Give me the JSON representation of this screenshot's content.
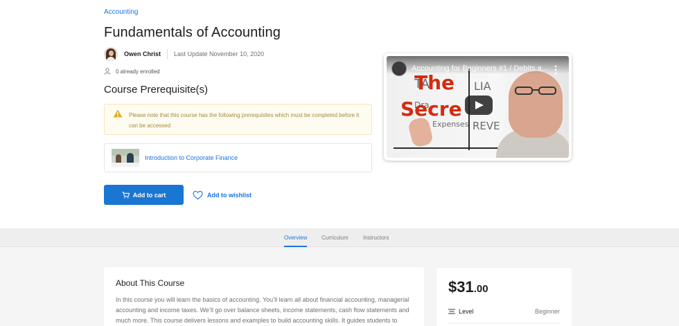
{
  "breadcrumb": {
    "category": "Accounting"
  },
  "course": {
    "title": "Fundamentals of Accounting",
    "author": "Owen Christ",
    "last_update": "Last Update November 10, 2020",
    "enrolled": "0 already enrolled"
  },
  "prerequisites": {
    "heading": "Course Prerequisite(s)",
    "notice": "Please note that this course has the following prerequisites which must be completed before it can be accessed",
    "items": [
      {
        "title": "Introduction to Corporate Finance"
      }
    ]
  },
  "actions": {
    "add_to_cart": "Add to cart",
    "add_to_wishlist": "Add to wishlist"
  },
  "video": {
    "title": "Accounting for Beginners #1 / Debits a...",
    "overlay_big_text_1": "The",
    "overlay_big_text_2": "Secre",
    "board_words": [
      "TA",
      "LIA",
      "Dra",
      "Expenses",
      "REVE"
    ]
  },
  "tabs": [
    {
      "label": "Overview",
      "active": true
    },
    {
      "label": "Curriculum",
      "active": false
    },
    {
      "label": "Instructors",
      "active": false
    }
  ],
  "about": {
    "heading": "About This Course",
    "body": "In this course you will learn the basics of accounting. You’ll learn all about financial accounting, managerial accounting and income taxes. We’ll go over balance sheets, income statements, cash flow statements and much more. This course delivers lessons and examples to build accounting skills. It guides students to"
  },
  "pricing": {
    "price_main": "$31",
    "price_cents": ".00",
    "level_label": "Level",
    "level_value": "Beginner"
  },
  "colors": {
    "accent": "#1a73e8",
    "button": "#1976d2",
    "notice_bg": "#fefbf0",
    "notice_text": "#a58a3c",
    "warning": "#e0b024"
  },
  "icons": {
    "user": "user-icon",
    "warning": "warning-icon",
    "cart": "cart-icon",
    "heart": "heart-icon",
    "play": "play-icon",
    "filter": "filter-icon",
    "more": "more-vertical-icon"
  }
}
